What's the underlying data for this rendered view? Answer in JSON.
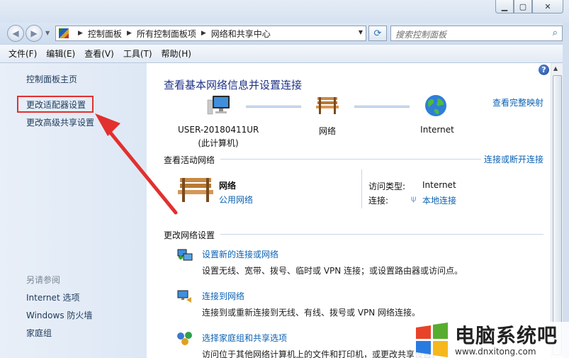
{
  "window": {
    "minimize_glyph": "▁",
    "maximize_glyph": "▢",
    "close_glyph": "✕"
  },
  "address": {
    "crumbs": [
      "控制面板",
      "所有控制面板项",
      "网络和共享中心"
    ],
    "search_placeholder": "搜索控制面板"
  },
  "menu": [
    "文件(F)",
    "编辑(E)",
    "查看(V)",
    "工具(T)",
    "帮助(H)"
  ],
  "sidebar": {
    "links": [
      "控制面板主页",
      "更改适配器设置",
      "更改高级共享设置"
    ],
    "see_also_header": "另请参阅",
    "see_also": [
      "Internet 选项",
      "Windows 防火墙",
      "家庭组"
    ],
    "highlight_color": "#e2302f"
  },
  "main": {
    "help": "?",
    "title": "查看基本网络信息并设置连接",
    "full_map_link": "查看完整映射",
    "map": {
      "computer_name": "USER-20180411UR",
      "computer_sub": "(此计算机)",
      "network": "网络",
      "internet": "Internet"
    },
    "active": {
      "header": "查看活动网络",
      "connect_link": "连接或断开连接",
      "network_name": "网络",
      "network_type": "公用网络",
      "access_label": "访问类型:",
      "access_value": "Internet",
      "connection_label": "连接:",
      "connection_value": "本地连接"
    },
    "change": {
      "header": "更改网络设置",
      "tasks": [
        {
          "link": "设置新的连接或网络",
          "desc": "设置无线、宽带、拨号、临时或 VPN 连接；或设置路由器或访问点。"
        },
        {
          "link": "连接到网络",
          "desc": "连接到或重新连接到无线、有线、拨号或 VPN 网络连接。"
        },
        {
          "link": "选择家庭组和共享选项",
          "desc": "访问位于其他网络计算机上的文件和打印机，或更改共享设置。"
        }
      ]
    }
  },
  "watermark": {
    "title": "电脑系统吧",
    "url": "www.dnxitong.com"
  },
  "colors": {
    "link": "#0b62b3",
    "title": "#1e3287",
    "sidebar_bg": "#dde8f5",
    "arrow": "#e2302f"
  }
}
